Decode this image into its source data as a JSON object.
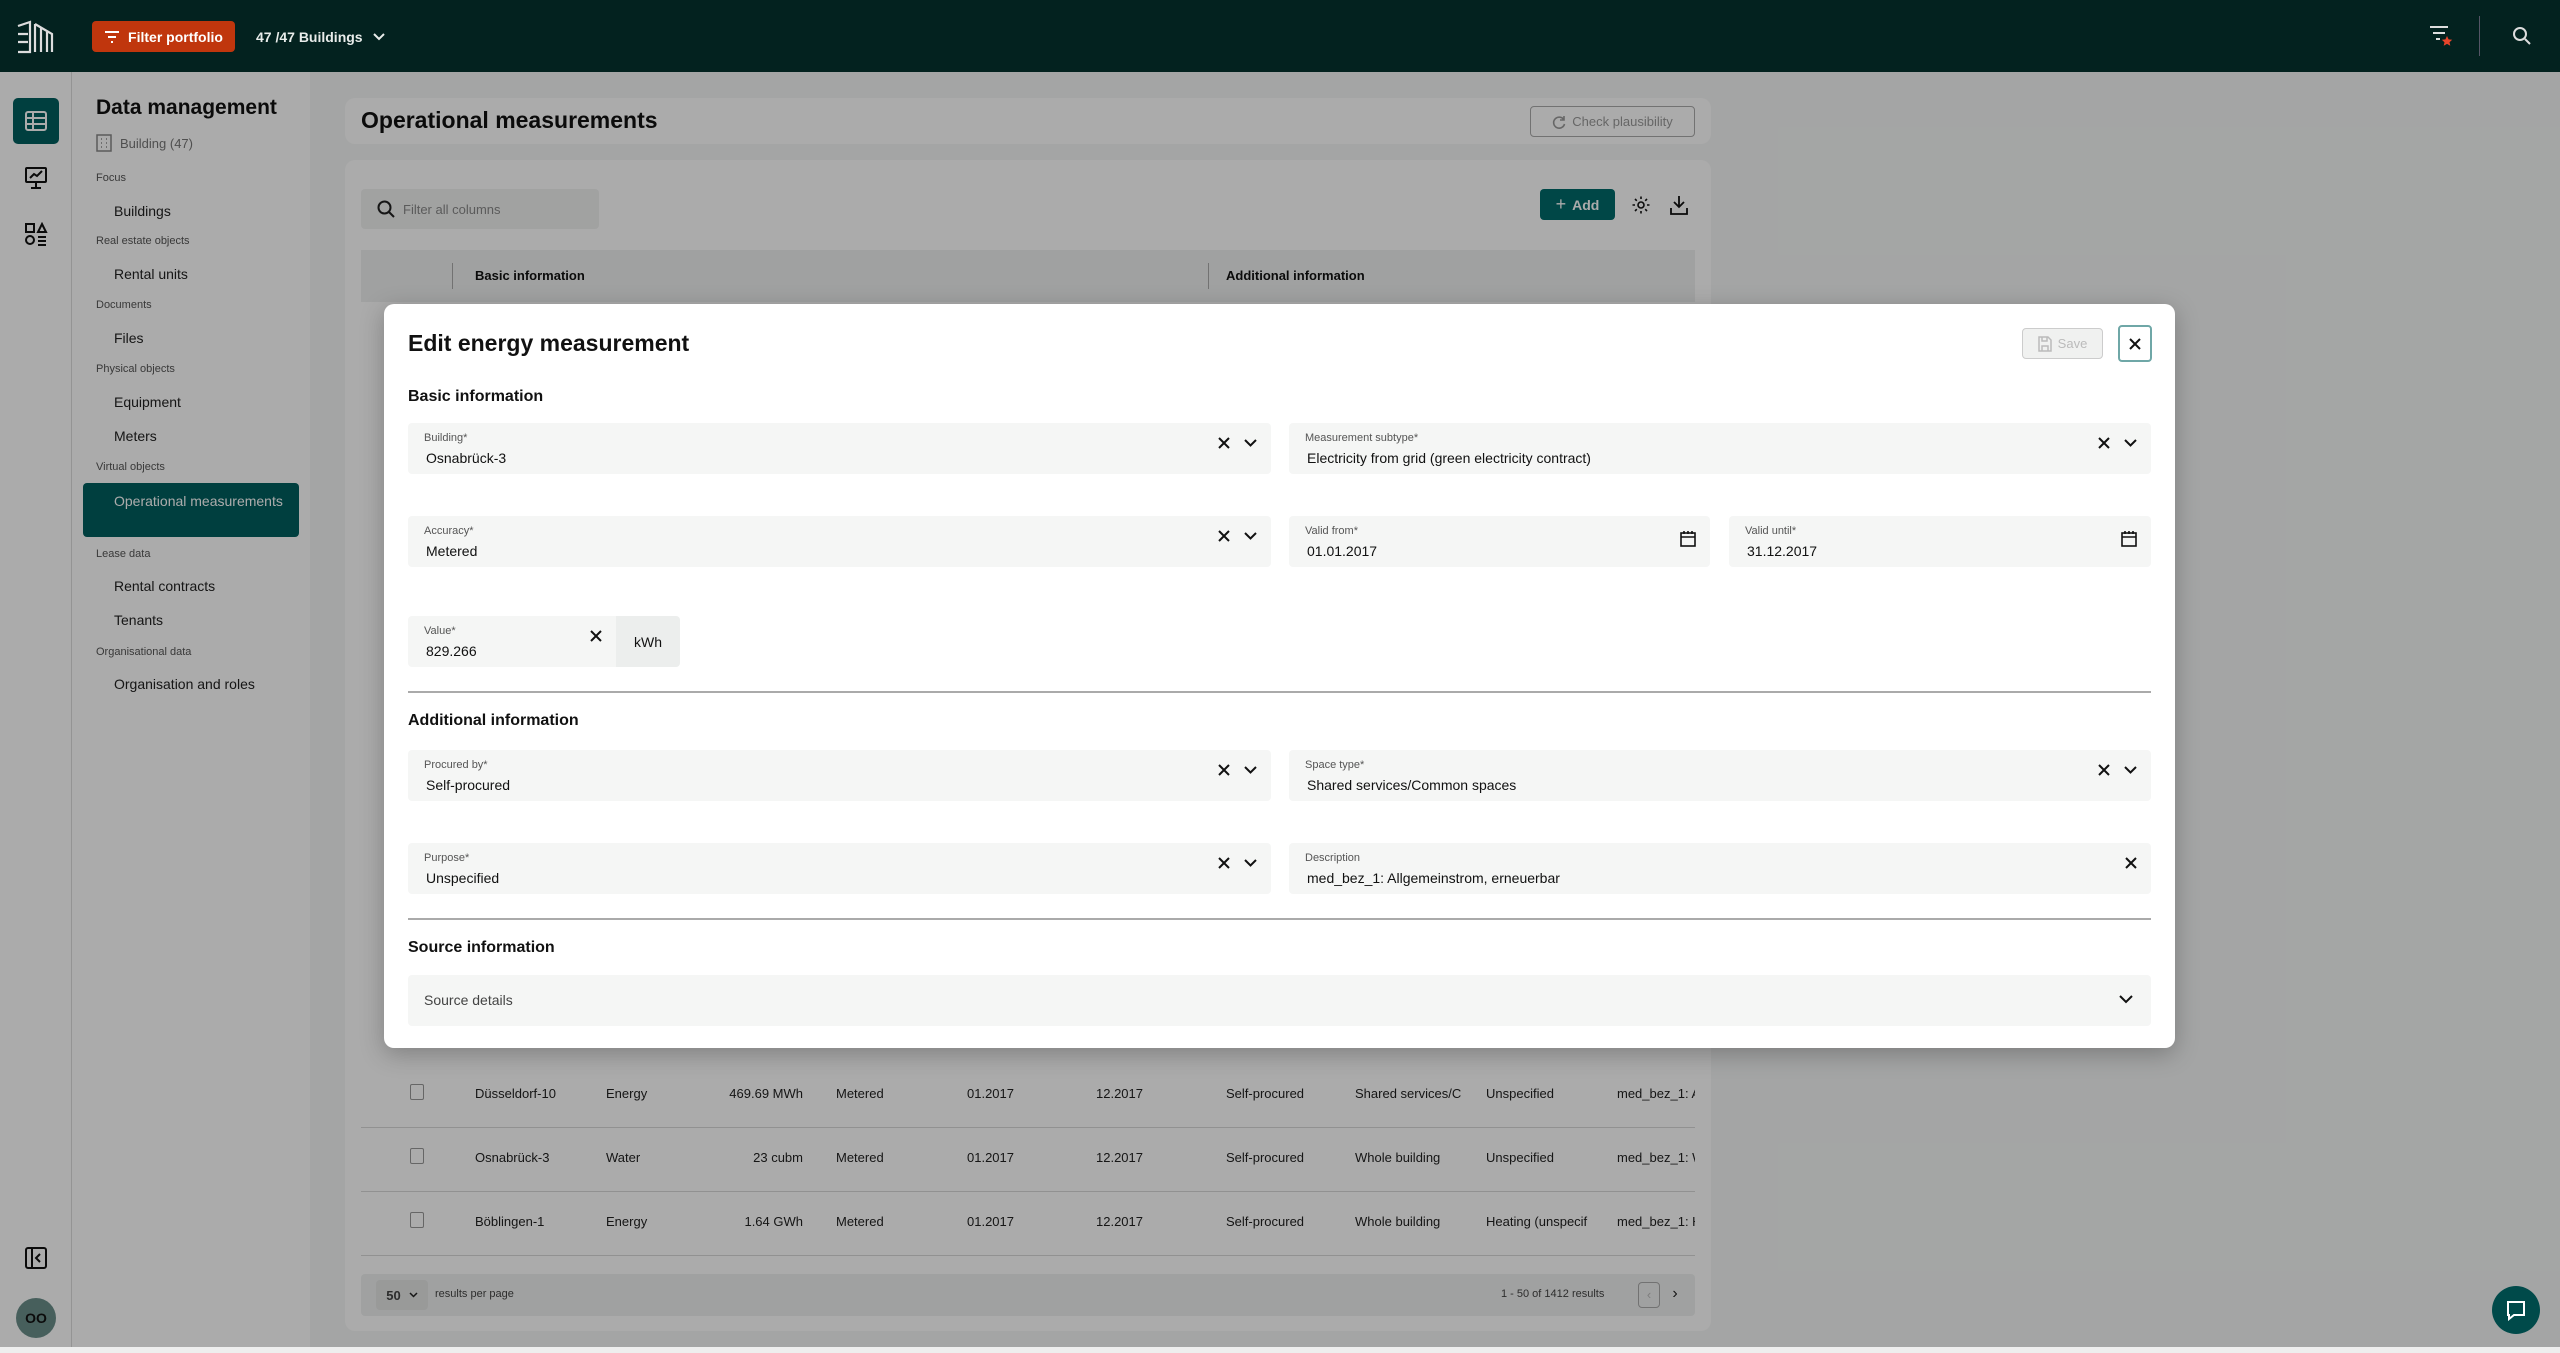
{
  "topbar": {
    "filter_label": "Filter portfolio",
    "buildings_selector": "47 /47 Buildings"
  },
  "rail": {
    "avatar_initials": "OO"
  },
  "sidebar": {
    "title": "Data management",
    "subtitle": "Building (47)",
    "groups": [
      {
        "label": "Focus",
        "items": [
          "Buildings"
        ]
      },
      {
        "label": "Real estate objects",
        "items": [
          "Rental units"
        ]
      },
      {
        "label": "Documents",
        "items": [
          "Files"
        ]
      },
      {
        "label": "Physical objects",
        "items": [
          "Equipment",
          "Meters"
        ]
      },
      {
        "label": "Virtual objects",
        "items": [
          "Operational measurements"
        ]
      },
      {
        "label": "Lease data",
        "items": [
          "Rental contracts",
          "Tenants"
        ]
      },
      {
        "label": "Organisational data",
        "items": [
          "Organisation and roles"
        ]
      }
    ],
    "active_item": "Operational measurements"
  },
  "page": {
    "title": "Operational measurements",
    "check_plausibility": "Check plausibility"
  },
  "toolbar": {
    "search_placeholder": "Filter all columns",
    "add_label": "Add"
  },
  "table": {
    "group_headers": [
      "Basic information",
      "Additional information"
    ],
    "rows": [
      [
        "Düsseldorf-10",
        "Energy",
        "469.69 MWh",
        "Metered",
        "01.2017",
        "12.2017",
        "Self-procured",
        "Shared services/C",
        "Unspecified",
        "med_bez_1: A"
      ],
      [
        "Osnabrück-3",
        "Water",
        "23 cubm",
        "Metered",
        "01.2017",
        "12.2017",
        "Self-procured",
        "Whole building",
        "Unspecified",
        "med_bez_1: W"
      ],
      [
        "Böblingen-1",
        "Energy",
        "1.64 GWh",
        "Metered",
        "01.2017",
        "12.2017",
        "Self-procured",
        "Whole building",
        "Heating (unspecif",
        "med_bez_1: H"
      ]
    ]
  },
  "footer": {
    "page_size": "50",
    "per_page_label": "results per page",
    "range": "1 - 50 of 1412 results"
  },
  "modal": {
    "title": "Edit energy measurement",
    "save_label": "Save",
    "sections": {
      "basic": "Basic information",
      "additional": "Additional information",
      "source": "Source information"
    },
    "fields": {
      "building": {
        "label": "Building*",
        "value": "Osnabrück-3"
      },
      "subtype": {
        "label": "Measurement subtype*",
        "value": "Electricity from grid (green electricity contract)"
      },
      "accuracy": {
        "label": "Accuracy*",
        "value": "Metered"
      },
      "valid_from": {
        "label": "Valid from*",
        "value": "01.01.2017"
      },
      "valid_until": {
        "label": "Valid until*",
        "value": "31.12.2017"
      },
      "value": {
        "label": "Value*",
        "value": "829.266",
        "unit": "kWh"
      },
      "procured_by": {
        "label": "Procured by*",
        "value": "Self-procured"
      },
      "space_type": {
        "label": "Space type*",
        "value": "Shared services/Common spaces"
      },
      "purpose": {
        "label": "Purpose*",
        "value": "Unspecified"
      },
      "description": {
        "label": "Description",
        "value": "med_bez_1: Allgemeinstrom, erneuerbar"
      },
      "source_details": {
        "label": "Source details"
      }
    }
  },
  "colors": {
    "topbar": "#03221f",
    "accent": "#006a6a",
    "filter_button": "#c0360d",
    "active_nav": "#005e5e"
  }
}
